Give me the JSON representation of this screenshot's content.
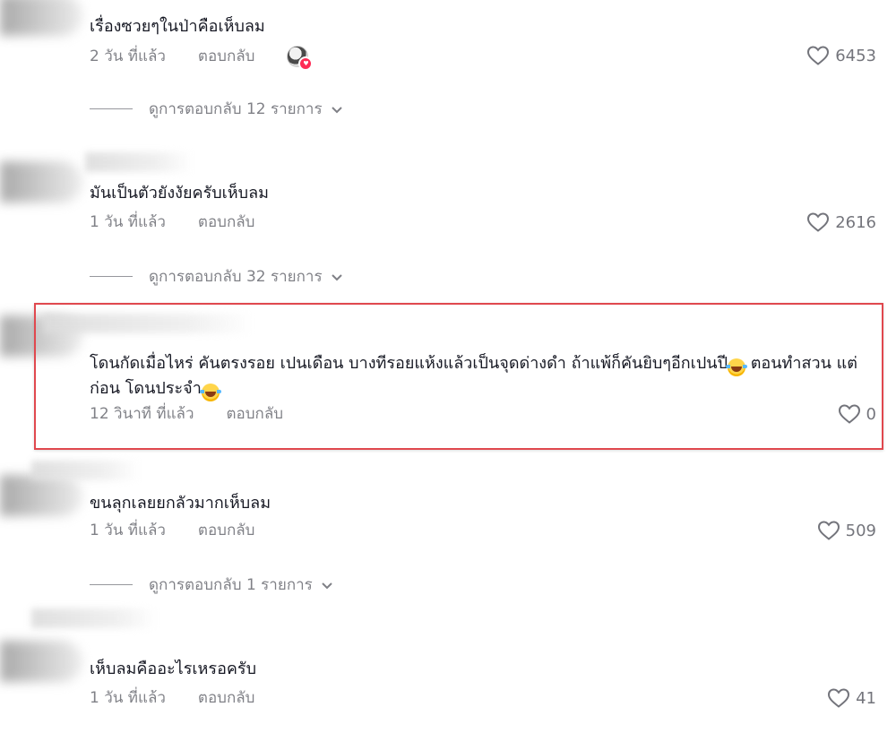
{
  "comments": [
    {
      "text": "เรื่องซวยๆในป่าคือเห็บลม",
      "time": "2 วัน ที่แล้ว",
      "reply_label": "ตอบกลับ",
      "likes": "6453",
      "creator_liked": true,
      "replies_label": "ดูการตอบกลับ 12 รายการ"
    },
    {
      "text": "มันเป็นตัวยังงัยครับเห็บลม",
      "time": "1 วัน ที่แล้ว",
      "reply_label": "ตอบกลับ",
      "likes": "2616",
      "replies_label": "ดูการตอบกลับ 32 รายการ"
    },
    {
      "text_part1": "โดนกัดเมื่อไหร่ คันตรงรอย เปนเดือน บางทีรอยแห้งแล้วเป็นจุดด่างดำ ถ้าแพ้ก็คันยิบๆอีกเปนปี",
      "text_part2": " ตอนทำสวน แต่ก่อน โดนประจำ",
      "time": "12 วินาที ที่แล้ว",
      "reply_label": "ตอบกลับ",
      "likes": "0",
      "highlighted": true
    },
    {
      "text": "ขนลุกเลยยกลัวมากเห็บลม",
      "time": "1 วัน ที่แล้ว",
      "reply_label": "ตอบกลับ",
      "likes": "509",
      "replies_label": "ดูการตอบกลับ 1 รายการ"
    },
    {
      "text": "เห็บลมคืออะไรเหรอครับ",
      "time": "1 วัน ที่แล้ว",
      "reply_label": "ตอบกลับ",
      "likes": "41"
    }
  ],
  "icons": {
    "like": "heart-outline-icon",
    "expand": "chevron-down-icon",
    "emoji": "rolling-laughing-emoji",
    "creator_badge": "heart-badge-icon"
  },
  "colors": {
    "highlight_border": "#e0484e",
    "creator_heart": "#fe2c55",
    "text_primary": "#161823"
  }
}
